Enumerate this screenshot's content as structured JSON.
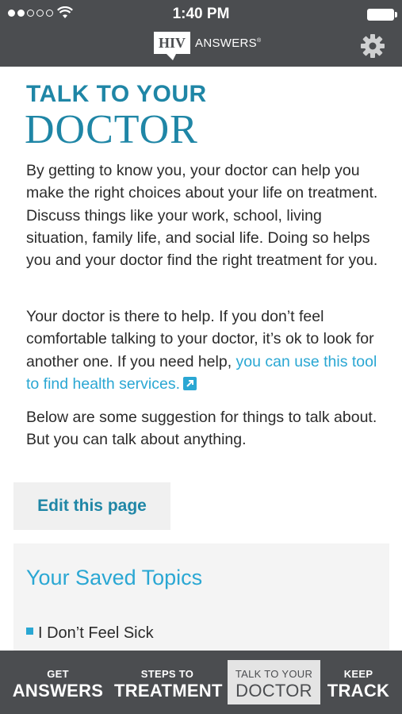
{
  "status": {
    "time": "1:40 PM"
  },
  "header": {
    "logo_box": "HIV",
    "logo_text": "ANSWERS"
  },
  "content": {
    "title_line1": "TALK TO YOUR",
    "title_line2": "DOCTOR",
    "para1": "By getting to know you, your doctor can help you make the right choices about your life on treatment. Discuss things like your work, school, living situation, family life, and social life. Doing so helps you and your doctor find the right treatment for you.",
    "para2_text": "Your doctor is there to help. If you don’t feel comfortable talking to your doctor, it’s ok to look for another one. If you need help,",
    "para2_link": "you can use this tool to find health services.",
    "para3": "Below are some suggestion for things to talk about. But you can talk about anything.",
    "edit_button": "Edit this page",
    "saved_title": "Your Saved Topics",
    "saved_items": [
      "I Don’t Feel Sick"
    ]
  },
  "tabs": [
    {
      "small": "GET",
      "big": "ANSWERS"
    },
    {
      "small": "STEPS TO",
      "big": "TREATMENT"
    },
    {
      "small": "TALK TO YOUR",
      "big": "DOCTOR"
    },
    {
      "small": "KEEP",
      "big": "TRACK"
    }
  ]
}
